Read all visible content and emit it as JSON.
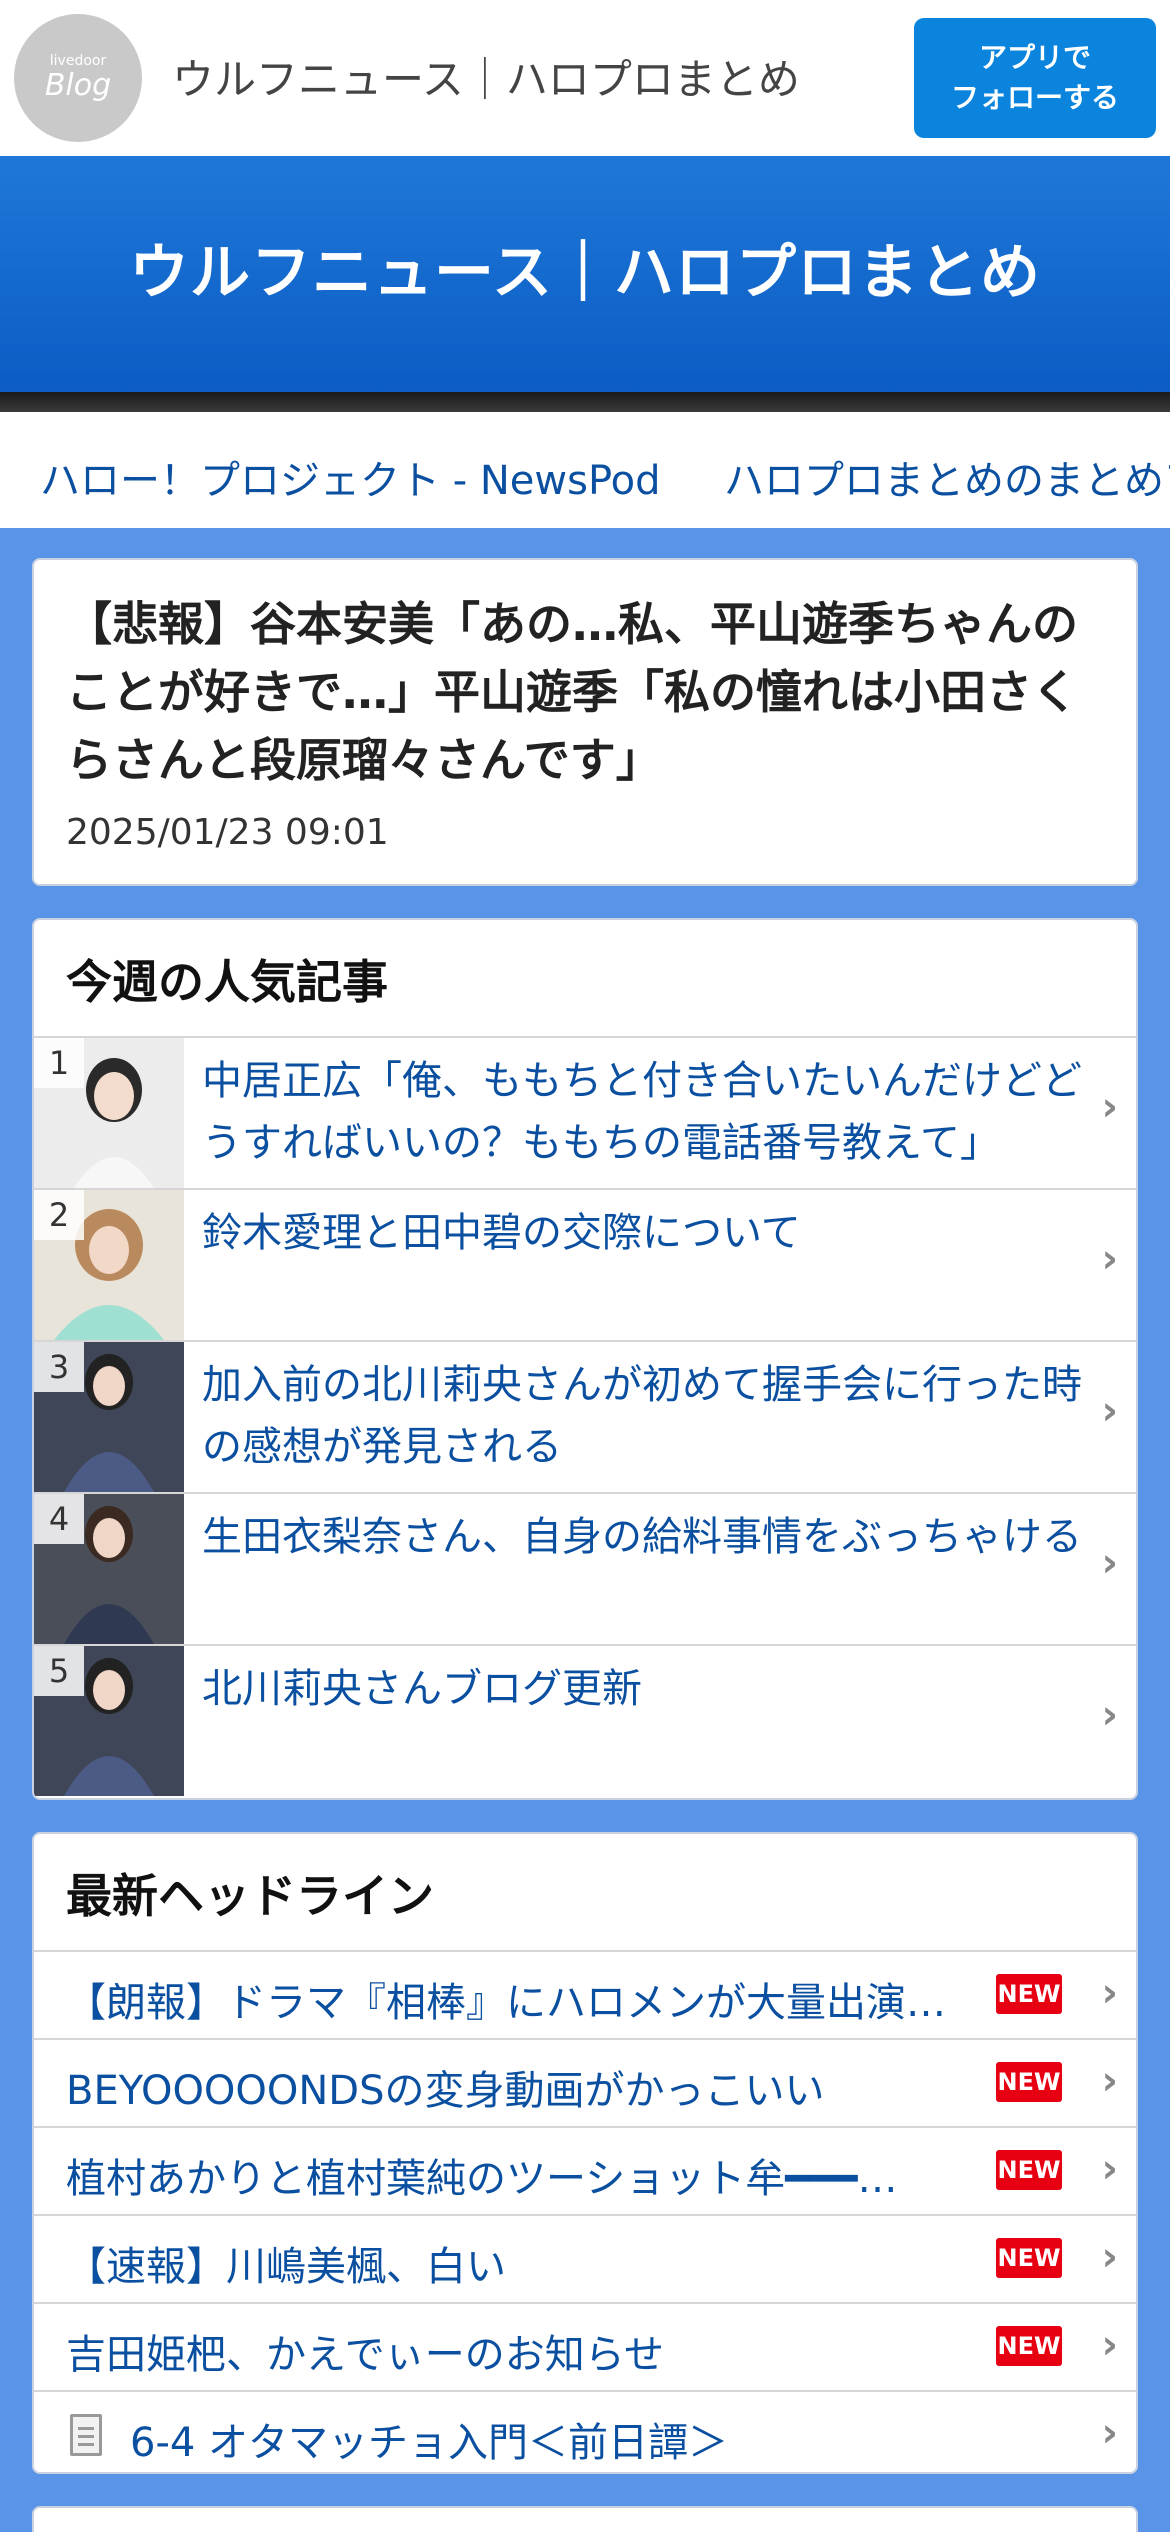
{
  "header": {
    "logo_small": "livedoor",
    "logo_big": "Blog",
    "site_name": "ウルフニュース｜ハロプロまとめ",
    "follow_line1": "アプリで",
    "follow_line2": "フォローする"
  },
  "banner": {
    "title": "ウルフニュース｜ハロプロまとめ"
  },
  "nav": {
    "links": [
      "ハロー！プロジェクト - NewsPod",
      "ハロプロまとめのまとめアンテナ"
    ]
  },
  "article": {
    "title": "【悲報】谷本安美「あの…私、平山遊季ちゃんのことが好きで…」平山遊季「私の憧れは小田さくらさんと段原瑠々さんです」",
    "date": "2025/01/23 09:01"
  },
  "popular": {
    "title": "今週の人気記事",
    "items": [
      {
        "rank": "1",
        "text": "中居正広「俺、ももちと付き合いたいんだけどどうすればいいの？ももちの電話番号教えて」"
      },
      {
        "rank": "2",
        "text": "鈴木愛理と田中碧の交際について"
      },
      {
        "rank": "3",
        "text": "加入前の北川莉央さんが初めて握手会に行った時の感想が発見される"
      },
      {
        "rank": "4",
        "text": "生田衣梨奈さん、自身の給料事情をぶっちゃける"
      },
      {
        "rank": "5",
        "text": "北川莉央さんブログ更新"
      }
    ]
  },
  "headlines": {
    "title": "最新ヘッドライン",
    "new_label": "NEW",
    "items": [
      {
        "text": "【朗報】ドラマ『相棒』にハロメンが大量出演…"
      },
      {
        "text": "BEYOOOOONDSの変身動画がかっこいい"
      },
      {
        "text": "植村あかりと植村葉純のツーショット牟━━━…"
      },
      {
        "text": "【速報】川嶋美楓、白い"
      },
      {
        "text": "吉田姫杷、かえでぃーのお知らせ"
      },
      {
        "text": "6-4 オタマッチョ入門＜前日譚＞"
      }
    ]
  },
  "icons": {
    "chevron": "›"
  },
  "colors": {
    "page_bg": "#5a94e8",
    "brand_blue": "#0b84de",
    "banner_blue": "#1f78d8",
    "link_blue": "#0b4fa0",
    "new_red": "#e60012"
  }
}
